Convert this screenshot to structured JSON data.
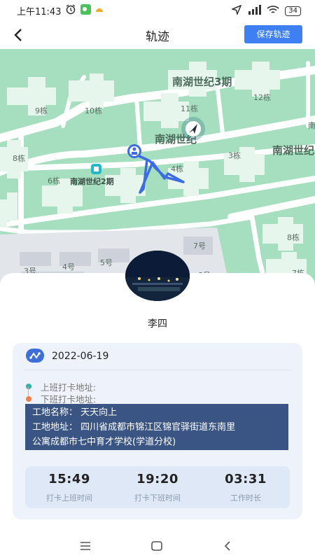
{
  "status_bar": {
    "time": "上午11:43",
    "battery": "34"
  },
  "nav": {
    "title": "轨迹",
    "save_label": "保存轨迹"
  },
  "map": {
    "labels": {
      "area3": "南湖世纪3期",
      "area_mid": "南湖世纪",
      "area_right": "南湖世纪",
      "area2": "南湖世纪2期",
      "b9": "9栋",
      "b10": "10栋",
      "b11": "11栋",
      "b12": "12栋",
      "b8": "8栋",
      "b6": "6栋",
      "b4": "4栋",
      "b3": "3栋",
      "b8r": "8栋",
      "b7r": "7栋",
      "g7": "7号",
      "g3": "3号",
      "g4": "4号",
      "g5": "5号",
      "g8": "8号",
      "edge_nan": "南"
    },
    "colors": {
      "land": "#a5dfbf",
      "road": "#ffffff",
      "block": "#e6f6ec",
      "track": "#3d6de0"
    }
  },
  "user": {
    "name": "李四"
  },
  "record": {
    "date": "2022-06-19",
    "checkin_label": "上班打卡地址:",
    "checkout_label": "下班打卡地址:",
    "site_name_line": "工地名称：  天天向上",
    "site_addr_line1": "工地地址：  四川省成都市锦江区锦官驿街道东南里",
    "site_addr_line2": "公寓成都市七中育才学校(学道分校)"
  },
  "stats": [
    {
      "value": "15:49",
      "label": "打卡上班时间"
    },
    {
      "value": "19:20",
      "label": "打卡下班时间"
    },
    {
      "value": "03:31",
      "label": "工作时长"
    }
  ]
}
